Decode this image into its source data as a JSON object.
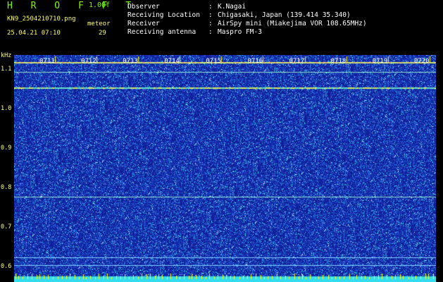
{
  "header": {
    "brand": "H R O F F T",
    "version": "1.00f",
    "filename": "KN9_2504210710.png",
    "timestamp": "25.04.21 07:10",
    "meteor_label": "meteor",
    "meteor_count": "29"
  },
  "station": {
    "rows": [
      {
        "label": "Observer",
        "value": "K.Nagai"
      },
      {
        "label": "Receiving Location",
        "value": "Chigasaki, Japan (139.414 35.340)"
      },
      {
        "label": "Receiver",
        "value": "AirSpy mini (Miakejima VOR 108.65MHz)"
      },
      {
        "label": "Receiving antenna",
        "value": "Maspro FM-3"
      }
    ]
  },
  "spectrogram": {
    "y_unit": "kHz",
    "y_ticks": [
      "1.1",
      "1.0",
      "0.9",
      "0.8",
      "0.7",
      "0.6"
    ],
    "y_range": [
      0.585,
      1.135
    ],
    "time_ticks": [
      "0711",
      "0712",
      "0713",
      "0714",
      "0715",
      "0716",
      "0717",
      "0718",
      "0719",
      "0720"
    ],
    "signal_lines_khz": [
      1.117,
      1.093,
      1.053,
      0.776,
      0.622,
      0.602
    ],
    "colors": {
      "background": "#1a2fa8",
      "label": "#ffff88",
      "tick": "#ffff00",
      "bottom_bar": "#33ddee"
    }
  }
}
